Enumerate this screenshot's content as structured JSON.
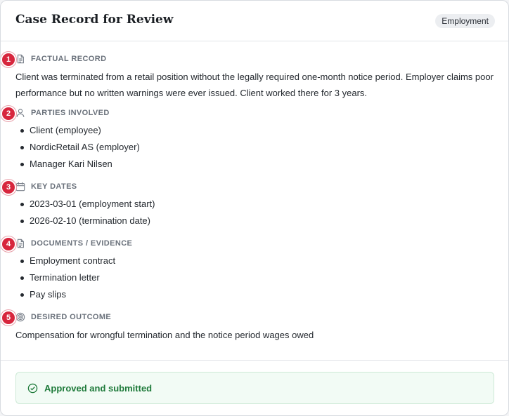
{
  "header": {
    "title": "Case Record for Review",
    "badge": "Employment"
  },
  "sections": [
    {
      "number": "1",
      "icon": "document-icon",
      "heading": "FACTUAL RECORD",
      "text": "Client was terminated from a retail position without the legally required one-month notice period. Employer claims poor performance but no written warnings were ever issued. Client worked there for 3 years."
    },
    {
      "number": "2",
      "icon": "person-icon",
      "heading": "PARTIES INVOLVED",
      "items": [
        "Client (employee)",
        "NordicRetail AS (employer)",
        "Manager Kari Nilsen"
      ]
    },
    {
      "number": "3",
      "icon": "calendar-icon",
      "heading": "KEY DATES",
      "items": [
        "2023-03-01 (employment start)",
        "2026-02-10 (termination date)"
      ]
    },
    {
      "number": "4",
      "icon": "document-icon",
      "heading": "DOCUMENTS / EVIDENCE",
      "items": [
        "Employment contract",
        "Termination letter",
        "Pay slips"
      ]
    },
    {
      "number": "5",
      "icon": "target-icon",
      "heading": "DESIRED OUTCOME",
      "text": "Compensation for wrongful termination and the notice period wages owed"
    }
  ],
  "footer": {
    "status": "Approved and submitted"
  },
  "colors": {
    "marker": "#d7263d",
    "success": "#1e7a3a",
    "success_bg": "#f2fbf5"
  }
}
